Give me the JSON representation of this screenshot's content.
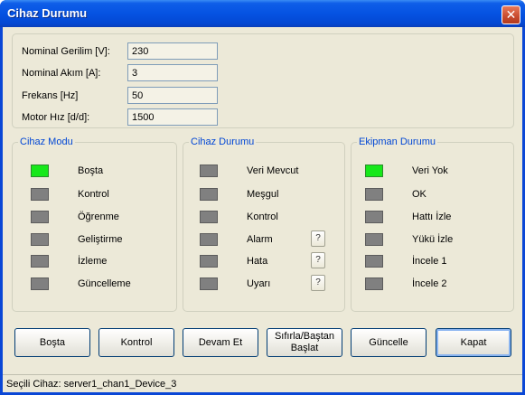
{
  "window": {
    "title": "Cihaz Durumu"
  },
  "params": [
    {
      "label": "Nominal Gerilim [V]:",
      "value": "230"
    },
    {
      "label": "Nominal Akım [A]:",
      "value": "3"
    },
    {
      "label": "Frekans [Hz]",
      "value": "50"
    },
    {
      "label": "Motor Hız [d/d]:",
      "value": "1500"
    }
  ],
  "groups": {
    "mode": {
      "title": "Cihaz Modu",
      "items": [
        {
          "label": "Boşta",
          "state": "on"
        },
        {
          "label": "Kontrol",
          "state": "off"
        },
        {
          "label": "Öğrenme",
          "state": "off"
        },
        {
          "label": "Geliştirme",
          "state": "off"
        },
        {
          "label": "İzleme",
          "state": "off"
        },
        {
          "label": "Güncelleme",
          "state": "off"
        }
      ]
    },
    "status": {
      "title": "Cihaz Durumu",
      "items": [
        {
          "label": "Veri Mevcut",
          "state": "off"
        },
        {
          "label": "Meşgul",
          "state": "off"
        },
        {
          "label": "Kontrol",
          "state": "off"
        },
        {
          "label": "Alarm",
          "state": "off",
          "help": "?"
        },
        {
          "label": "Hata",
          "state": "off",
          "help": "?"
        },
        {
          "label": "Uyarı",
          "state": "off",
          "help": "?"
        }
      ]
    },
    "equipment": {
      "title": "Ekipman Durumu",
      "items": [
        {
          "label": "Veri Yok",
          "state": "on"
        },
        {
          "label": "OK",
          "state": "off"
        },
        {
          "label": "Hattı İzle",
          "state": "off"
        },
        {
          "label": "Yükü İzle",
          "state": "off"
        },
        {
          "label": "İncele 1",
          "state": "off"
        },
        {
          "label": "İncele 2",
          "state": "off"
        }
      ]
    }
  },
  "buttons": {
    "idle": "Boşta",
    "control": "Kontrol",
    "continue": "Devam Et",
    "reset_line1": "Sıfırla/Baştan",
    "reset_line2": "Başlat",
    "update": "Güncelle",
    "close": "Kapat"
  },
  "statusbar": {
    "text": "Seçili Cihaz: server1_chan1_Device_3"
  },
  "colors": {
    "led_on": "#17e81a",
    "led_off": "#808080",
    "group_title": "#0046d5",
    "titlebar": "#0553e2"
  }
}
